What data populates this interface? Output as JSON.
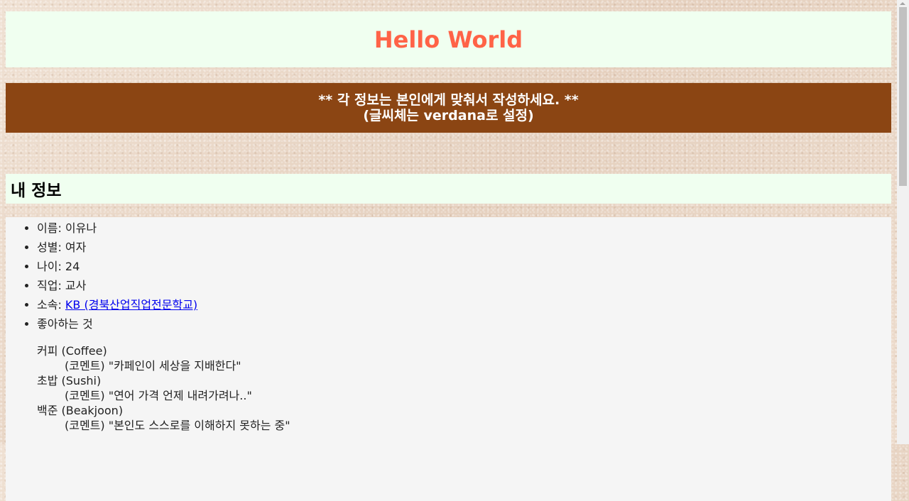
{
  "header": {
    "title": "Hello World"
  },
  "notice": {
    "line1": "** 각 정보는 본인에게 맞춰서 작성하세요. **",
    "line2": "(글씨체는 verdana로 설정)"
  },
  "section": {
    "heading": "내 정보"
  },
  "info": {
    "items": [
      {
        "text": "이름: 이유나"
      },
      {
        "text": "성별: 여자"
      },
      {
        "text": "나이: 24"
      },
      {
        "text": "직업: 교사"
      },
      {
        "label": "소속: ",
        "link": "KB (경북산업직업전문학교)"
      },
      {
        "text": "좋아하는 것"
      }
    ],
    "likes": [
      {
        "name": "커피 (Coffee)",
        "comment": "(코멘트) \"카페인이 세상을 지배한다\""
      },
      {
        "name": "초밥 (Sushi)",
        "comment": "(코멘트) \"연어 가격 언제 내려가려나..\""
      },
      {
        "name": "백준 (Beakjoon)",
        "comment": "(코멘트) \"본인도 스스로를 이해하지 못하는 중\""
      }
    ]
  },
  "colors": {
    "title": "#ff6347",
    "title_bg": "#f0fff0",
    "notice_bg": "#8b4513",
    "content_bg": "#f5f5f5",
    "link": "#0000ee"
  }
}
